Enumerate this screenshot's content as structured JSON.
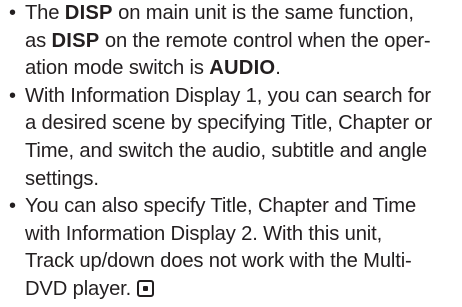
{
  "bullet_symbol": "•",
  "items": [
    {
      "lines": [
        {
          "segments": [
            {
              "text": "The ",
              "bold": false
            },
            {
              "text": "DISP",
              "bold": true
            },
            {
              "text": " on main unit is the same function,",
              "bold": false
            }
          ]
        },
        {
          "segments": [
            {
              "text": "as ",
              "bold": false
            },
            {
              "text": "DISP",
              "bold": true
            },
            {
              "text": " on the remote control when the oper-",
              "bold": false
            }
          ]
        },
        {
          "segments": [
            {
              "text": "ation mode switch is ",
              "bold": false
            },
            {
              "text": "AUDIO",
              "bold": true
            },
            {
              "text": ".",
              "bold": false
            }
          ]
        }
      ]
    },
    {
      "lines": [
        {
          "segments": [
            {
              "text": "With Information Display 1, you can search for",
              "bold": false
            }
          ]
        },
        {
          "segments": [
            {
              "text": "a desired scene by specifying Title, Chapter or",
              "bold": false
            }
          ]
        },
        {
          "segments": [
            {
              "text": "Time, and switch the audio, subtitle and angle",
              "bold": false
            }
          ]
        },
        {
          "segments": [
            {
              "text": "settings.",
              "bold": false
            }
          ]
        }
      ]
    },
    {
      "lines": [
        {
          "segments": [
            {
              "text": "You can also specify Title, Chapter and Time",
              "bold": false
            }
          ]
        },
        {
          "segments": [
            {
              "text": "with Information Display 2. With this unit,",
              "bold": false
            }
          ]
        },
        {
          "segments": [
            {
              "text": "Track up/down does not work with the Multi-",
              "bold": false
            }
          ]
        },
        {
          "segments": [
            {
              "text": "DVD player.",
              "bold": false
            }
          ]
        }
      ],
      "end_mark_icon": "section-end-square-icon"
    }
  ]
}
